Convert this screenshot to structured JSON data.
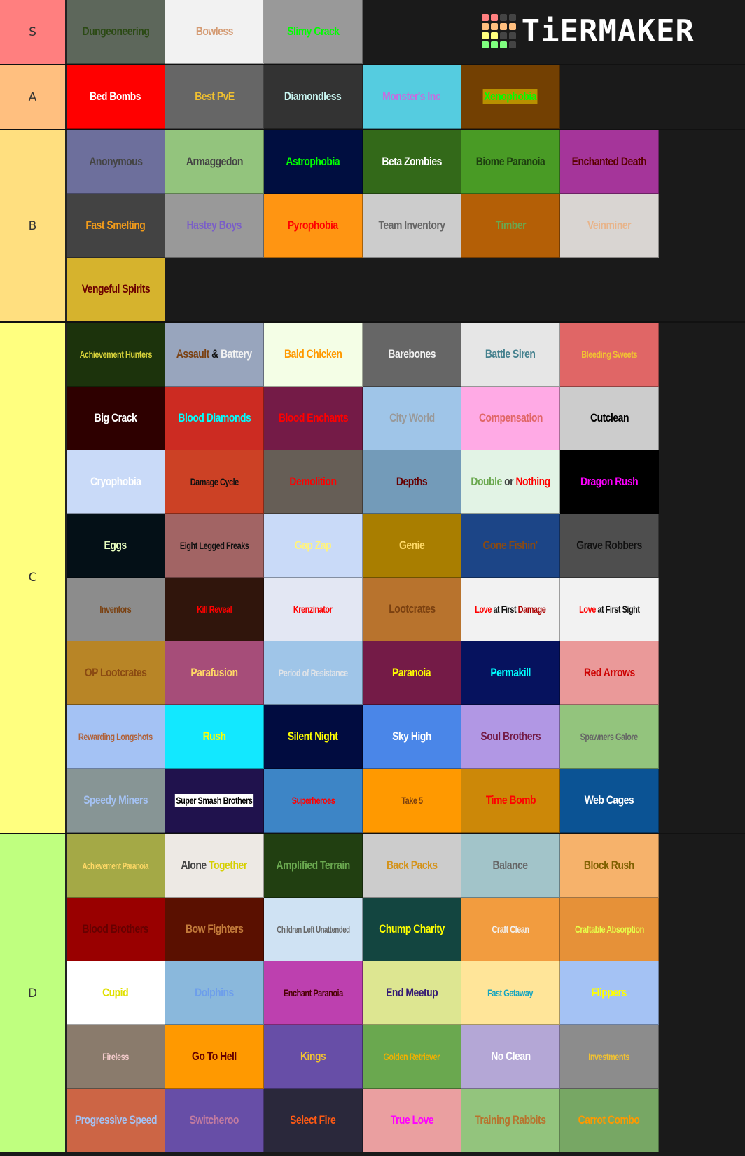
{
  "brand": {
    "logo_text": "TiERMAKER",
    "logo_grid_colors": [
      "#ff7f7f",
      "#ff7f7f",
      "#444444",
      "#444444",
      "#ffbf7f",
      "#ffbf7f",
      "#ffbf7f",
      "#ffbf7f",
      "#ffff7f",
      "#ffff7f",
      "#444444",
      "#444444",
      "#7fff7f",
      "#7fff7f",
      "#7fff7f",
      "#444444"
    ]
  },
  "tiers": [
    {
      "label": "S",
      "color": "#ff7f7f",
      "items": [
        {
          "text": "Dungeoneering",
          "bg": "#5d675b",
          "fg": "#2b4a14"
        },
        {
          "text": "Bowless",
          "bg": "#f2f2f2",
          "fg": "#d49a72"
        },
        {
          "text": "Slimy Crack",
          "bg": "#999999",
          "fg": "#00ff00"
        }
      ]
    },
    {
      "label": "A",
      "color": "#ffbf7f",
      "items": [
        {
          "text": "Bed Bombs",
          "bg": "#ff0000",
          "fg": "#ffffff"
        },
        {
          "text": "Best PvE",
          "bg": "#666666",
          "fg": "#f0c030"
        },
        {
          "text": "Diamondless",
          "bg": "#333333",
          "fg": "#c8f5f0"
        },
        {
          "text": "Monster's Inc",
          "bg": "#55cce0",
          "fg": "#c86ae0"
        },
        {
          "text": "Xenophobia",
          "bg": "#734002",
          "fg": "#00ff00",
          "highlight": "#b89000"
        }
      ]
    },
    {
      "label": "B",
      "color": "#ffdf7f",
      "items": [
        {
          "text": "Anonymous",
          "bg": "#6d6f9c",
          "fg": "#444444"
        },
        {
          "text": "Armaggedon",
          "bg": "#93c47d",
          "fg": "#444444"
        },
        {
          "text": "Astrophobia",
          "bg": "#000e40",
          "fg": "#00ff00"
        },
        {
          "text": "Beta Zombies",
          "bg": "#336919",
          "fg": "#ffffff"
        },
        {
          "text": "Biome Paranoia",
          "bg": "#499b25",
          "fg": "#1e4010"
        },
        {
          "text": "Enchanted Death",
          "bg": "#a5359a",
          "fg": "#5a0000"
        },
        {
          "text": "Fast Smelting",
          "bg": "#434343",
          "fg": "#f39c1a"
        },
        {
          "text": "Hastey Boys",
          "bg": "#999999",
          "fg": "#7a5ec8"
        },
        {
          "text": "Pyrophobia",
          "bg": "#ff9512",
          "fg": "#ff0000"
        },
        {
          "text": "Team Inventory",
          "bg": "#cccccc",
          "fg": "#666666"
        },
        {
          "text": "Timber",
          "bg": "#b45f06",
          "fg": "#6aa84f"
        },
        {
          "text": "Veinminer",
          "bg": "#d9d5d2",
          "fg": "#e8b48a"
        },
        {
          "text": "Vengeful Spirits",
          "bg": "#d6b32d",
          "fg": "#6a0000"
        }
      ]
    },
    {
      "label": "C",
      "color": "#ffff7f",
      "items": [
        {
          "text": "Achievement Hunters",
          "bg": "#1c330c",
          "fg": "#d6d13a",
          "size": "small"
        },
        {
          "parts": [
            {
              "text": "Assault ",
              "fg": "#7a4010"
            },
            {
              "text": "& ",
              "fg": "#111111"
            },
            {
              "text": "Battery",
              "fg": "#f2f2f2"
            }
          ],
          "bg": "#98a5bd"
        },
        {
          "text": "Bald Chicken",
          "bg": "#f4fee6",
          "fg": "#ff9900"
        },
        {
          "text": "Barebones",
          "bg": "#666666",
          "fg": "#f2f2f2"
        },
        {
          "text": "Battle Siren",
          "bg": "#e6e6e6",
          "fg": "#45818e"
        },
        {
          "text": "Bleeding Sweets",
          "bg": "#e06666",
          "fg": "#f1c232",
          "size": "small"
        },
        {
          "text": "Big Crack",
          "bg": "#2e0000",
          "fg": "#ffffff"
        },
        {
          "text": "Blood Diamonds",
          "bg": "#cc2b22",
          "fg": "#00ffff"
        },
        {
          "text": "Blood Enchants",
          "bg": "#741b47",
          "fg": "#ff0000"
        },
        {
          "text": "City World",
          "bg": "#9fc5e8",
          "fg": "#999999"
        },
        {
          "text": "Compensation",
          "bg": "#ffaae5",
          "fg": "#e06666"
        },
        {
          "text": "Cutclean",
          "bg": "#cccccc",
          "fg": "#000000"
        },
        {
          "text": "Cryophobia",
          "bg": "#c9daf8",
          "fg": "#ffffff"
        },
        {
          "text": "Damage Cycle",
          "bg": "#cc4125",
          "fg": "#111111",
          "size": "small"
        },
        {
          "text": "Demolition",
          "bg": "#665e56",
          "fg": "#ff0000"
        },
        {
          "text": "Depths",
          "bg": "#739bb9",
          "fg": "#660000"
        },
        {
          "parts": [
            {
              "text": "Double ",
              "fg": "#6aa84f"
            },
            {
              "text": "or ",
              "fg": "#434343"
            },
            {
              "text": "Nothing",
              "fg": "#ff0000"
            }
          ],
          "bg": "#e2f3e5"
        },
        {
          "text": "Dragon Rush",
          "bg": "#000000",
          "fg": "#ff00ff"
        },
        {
          "text": "Eggs",
          "bg": "#041017",
          "fg": "#eaffc0"
        },
        {
          "text": "Eight Legged Freaks",
          "bg": "#a26464",
          "fg": "#111111",
          "size": "small"
        },
        {
          "text": "Gap Zap",
          "bg": "#c9daf8",
          "fg": "#fff37f"
        },
        {
          "text": "Genie",
          "bg": "#a97e00",
          "fg": "#ffd966"
        },
        {
          "text": "Gone Fishin'",
          "bg": "#1c4587",
          "fg": "#8a4a12"
        },
        {
          "text": "Grave Robbers",
          "bg": "#4e4e4e",
          "fg": "#111111"
        },
        {
          "text": "Inventors",
          "bg": "#8c8c8c",
          "fg": "#7a4010",
          "size": "small"
        },
        {
          "text": "Kill Reveal",
          "bg": "#30150c",
          "fg": "#ff0000",
          "size": "small"
        },
        {
          "text": "Krenzinator",
          "bg": "#e3e7f3",
          "fg": "#ff0000",
          "size": "small"
        },
        {
          "text": "Lootcrates",
          "bg": "#b8732d",
          "fg": "#7a4010"
        },
        {
          "parts": [
            {
              "text": "Love ",
              "fg": "#ff0000"
            },
            {
              "text": "at First ",
              "fg": "#111111"
            },
            {
              "text": "Damage",
              "fg": "#aa0000"
            }
          ],
          "bg": "#f2f2f2",
          "size": "small"
        },
        {
          "parts": [
            {
              "text": "Love ",
              "fg": "#ff0000"
            },
            {
              "text": "at First Sight",
              "fg": "#111111"
            }
          ],
          "bg": "#f2f2f2",
          "size": "small"
        },
        {
          "text": "OP Lootcrates",
          "bg": "#b88526",
          "fg": "#8a4a12"
        },
        {
          "text": "Parafusion",
          "bg": "#a64d79",
          "fg": "#ffd966"
        },
        {
          "text": "Period of Resistance",
          "bg": "#9fc5e8",
          "fg": "#dfe3e8",
          "size": "small"
        },
        {
          "text": "Paranoia",
          "bg": "#741b47",
          "fg": "#ffff00"
        },
        {
          "text": "Permakill",
          "bg": "#06125e",
          "fg": "#00ffff"
        },
        {
          "text": "Red Arrows",
          "bg": "#ea9999",
          "fg": "#cc0000"
        },
        {
          "text": "Rewarding Longshots",
          "bg": "#a4c2f4",
          "fg": "#b0623a",
          "size": "small"
        },
        {
          "text": "Rush",
          "bg": "#12e8ff",
          "fg": "#ffff00"
        },
        {
          "text": "Silent Night",
          "bg": "#010c40",
          "fg": "#ffff00"
        },
        {
          "text": "Sky High",
          "bg": "#4a86e8",
          "fg": "#ffffff"
        },
        {
          "text": "Soul Brothers",
          "bg": "#b197e4",
          "fg": "#741b47"
        },
        {
          "text": "Spawners Galore",
          "bg": "#93c47d",
          "fg": "#666666",
          "size": "small"
        },
        {
          "text": "Speedy Miners",
          "bg": "#879595",
          "fg": "#a4c2f4"
        },
        {
          "text": "Super Smash Brothers",
          "bg": "#20124d",
          "fg": "#000000",
          "highlight": "#ffffff",
          "size": "small"
        },
        {
          "text": "Superheroes",
          "bg": "#3d85c6",
          "fg": "#ff0000",
          "size": "small"
        },
        {
          "text": "Take 5",
          "bg": "#ff9900",
          "fg": "#7a4010",
          "size": "small"
        },
        {
          "text": "Time Bomb",
          "bg": "#cc8808",
          "fg": "#ff0000"
        },
        {
          "text": "Web Cages",
          "bg": "#0b5394",
          "fg": "#ffffff"
        }
      ]
    },
    {
      "label": "D",
      "color": "#bfff7f",
      "items": [
        {
          "text": "Achievement Paranoia",
          "bg": "#a4a946",
          "fg": "#ffd966",
          "size": "tiny"
        },
        {
          "parts": [
            {
              "text": "Alone ",
              "fg": "#434343"
            },
            {
              "text": "Together",
              "fg": "#d6cf00"
            }
          ],
          "bg": "#ede9e4"
        },
        {
          "text": "Amplified Terrain",
          "bg": "#213f11",
          "fg": "#6aa84f"
        },
        {
          "text": "Back Packs",
          "bg": "#cccccc",
          "fg": "#d4931a"
        },
        {
          "text": "Balance",
          "bg": "#a2c4c9",
          "fg": "#666666"
        },
        {
          "text": "Block Rush",
          "bg": "#f6b26b",
          "fg": "#7f6000"
        },
        {
          "text": "Blood Brothers",
          "bg": "#990000",
          "fg": "#660000"
        },
        {
          "text": "Bow Fighters",
          "bg": "#5a1000",
          "fg": "#c27a3a"
        },
        {
          "text": "Children Left Unattended",
          "bg": "#cfe2f3",
          "fg": "#666666",
          "size": "tiny"
        },
        {
          "text": "Chump Charity",
          "bg": "#134540",
          "fg": "#ffff00"
        },
        {
          "text": "Craft Clean",
          "bg": "#f29c3f",
          "fg": "#f2f2f2",
          "size": "small"
        },
        {
          "text": "Craftable Absorption",
          "bg": "#e69138",
          "fg": "#e6ff4a",
          "size": "small"
        },
        {
          "text": "Cupid",
          "bg": "#ffffff",
          "fg": "#e0e000"
        },
        {
          "text": "Dolphins",
          "bg": "#8ab8dc",
          "fg": "#6d9eeb"
        },
        {
          "text": "Enchant Paranoia",
          "bg": "#bd40af",
          "fg": "#4a0000",
          "size": "small"
        },
        {
          "text": "End Meetup",
          "bg": "#dde691",
          "fg": "#351c75"
        },
        {
          "text": "Fast Getaway",
          "bg": "#ffe599",
          "fg": "#15a5c0",
          "size": "small"
        },
        {
          "text": "Flippers",
          "bg": "#a4c2f4",
          "fg": "#ffff00"
        },
        {
          "text": "Fireless",
          "bg": "#8a7b6c",
          "fg": "#f4cccc",
          "size": "small"
        },
        {
          "text": "Go To Hell",
          "bg": "#ff9900",
          "fg": "#660000"
        },
        {
          "text": "Kings",
          "bg": "#674ea7",
          "fg": "#f1c232"
        },
        {
          "text": "Golden Retriever",
          "bg": "#6aa84f",
          "fg": "#f1b000",
          "size": "small"
        },
        {
          "text": "No Clean",
          "bg": "#b4a7d6",
          "fg": "#ffffff"
        },
        {
          "text": "Investments",
          "bg": "#8c8c8c",
          "fg": "#f1c232",
          "size": "small"
        },
        {
          "text": "Progressive Speed",
          "bg": "#cc6545",
          "fg": "#a4c2f4"
        },
        {
          "text": "Switcheroo",
          "bg": "#674ea7",
          "fg": "#c27ba0"
        },
        {
          "text": "Select Fire",
          "bg": "#2a283b",
          "fg": "#ff5a14"
        },
        {
          "text": "True Love",
          "bg": "#ea9fa0",
          "fg": "#ff00ff"
        },
        {
          "text": "Training Rabbits",
          "bg": "#93c47d",
          "fg": "#b8732d"
        },
        {
          "text": "Carrot Combo",
          "bg": "#77a764",
          "fg": "#ff9900"
        }
      ]
    }
  ]
}
